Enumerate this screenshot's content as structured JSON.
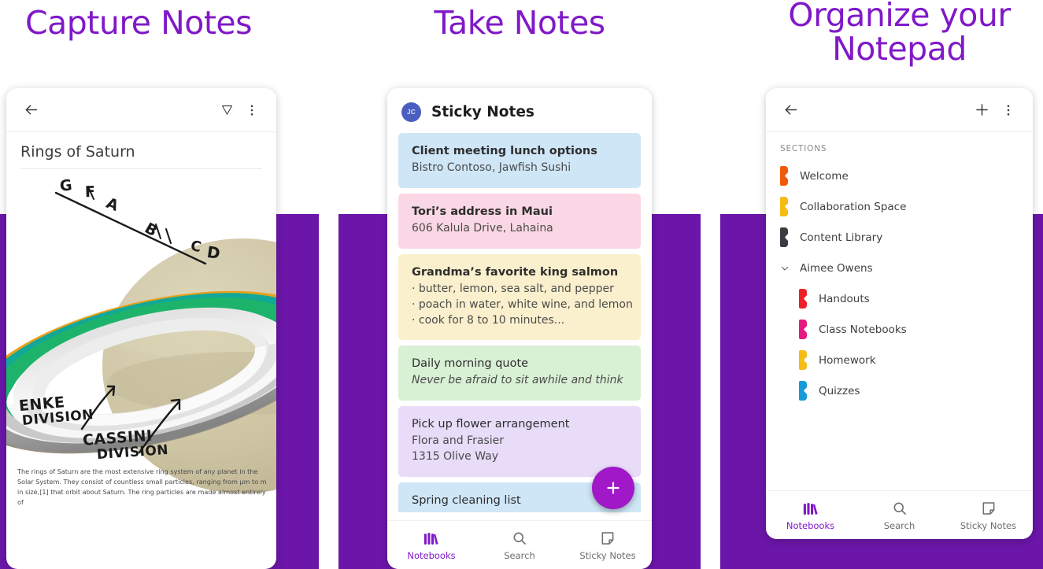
{
  "theme": {
    "purple_backdrop": "#6b16a8",
    "heading_purple": "#8019c8",
    "accent": "#a018c8"
  },
  "panels": [
    {
      "heading": "Capture Notes"
    },
    {
      "heading": "Take Notes"
    },
    {
      "heading": "Organize your\nNotepad"
    }
  ],
  "note_editor": {
    "heading": "Capture Notes",
    "back_icon": "back-arrow-icon",
    "ink_icon": "ink-pen-icon",
    "overflow_icon": "more-vertical-icon",
    "title": "Rings of Saturn",
    "drawing": {
      "ring_labels": [
        "G",
        "F",
        "A",
        "B",
        "C",
        "D"
      ],
      "annotations": [
        "ENKE\nDIVISION",
        "CASSINI\nDIVISION"
      ],
      "annotation_1_line_1": "ENKE",
      "annotation_1_line_2": "DIVISION",
      "annotation_2_line_1": "CASSINI",
      "annotation_2_line_2": "DIVISION",
      "ring_colors": [
        "#e8a11c",
        "#12a898",
        "#1eb36a",
        "#8d8d8d",
        "#cfcfcf",
        "#f2f2f2"
      ],
      "planet_color": "#cdc4a3"
    },
    "body_text": "The rings of Saturn are the most extensive ring system of any planet in the Solar System. They consist of countless small particles, ranging from µm to m in size,[1] that orbit about Saturn. The ring particles are made almost entirely of"
  },
  "sticky_notes": {
    "heading": "Take Notes",
    "avatar_initials": "JC",
    "avatar_color": "#4a5ec0",
    "app_title": "Sticky Notes",
    "fab_icon": "plus-icon",
    "notes": [
      {
        "color": "#cfe6f7",
        "title": "Client meeting lunch options",
        "lines": [
          "Bistro Contoso, Jawfish Sushi"
        ],
        "title_bold": true
      },
      {
        "color": "#fad7e4",
        "title": "Tori’s address in Maui",
        "lines": [
          "606 Kalula Drive, Lahaina"
        ],
        "title_bold": true
      },
      {
        "color": "#fbf0cd",
        "title": "Grandma’s favorite king salmon",
        "lines": [
          "· butter, lemon, sea salt, and pepper",
          "· poach in water, white wine, and lemon",
          "· cook for 8 to 10 minutes..."
        ],
        "title_bold": true
      },
      {
        "color": "#d8f0d4",
        "title": "Daily morning quote",
        "lines": [
          "Never be afraid to sit awhile and think"
        ],
        "title_bold": false,
        "lines_italic": true
      },
      {
        "color": "#e8dcf8",
        "title": "Pick up flower arrangement",
        "lines": [
          "Flora and Frasier",
          "1315 Olive Way"
        ],
        "title_bold": false
      },
      {
        "color": "#cfe6f7",
        "title": "Spring cleaning list",
        "lines": [],
        "title_bold": false
      }
    ],
    "bottom_nav": [
      {
        "label": "Notebooks",
        "icon": "notebooks-icon",
        "active": true
      },
      {
        "label": "Search",
        "icon": "search-icon",
        "active": false
      },
      {
        "label": "Sticky Notes",
        "icon": "sticky-note-icon",
        "active": false
      }
    ]
  },
  "notepad": {
    "heading": "Organize your Notepad",
    "back_icon": "back-arrow-icon",
    "add_icon": "plus-icon",
    "overflow_icon": "more-vertical-icon",
    "sections_label": "SECTIONS",
    "sections": [
      {
        "name": "Welcome",
        "color": "#f05a0f",
        "indent": false
      },
      {
        "name": "Collaboration Space",
        "color": "#f6bb15",
        "indent": false
      },
      {
        "name": "Content Library",
        "color": "#3b3b43",
        "indent": false
      }
    ],
    "group": {
      "name": "Aimee Owens",
      "expanded": true,
      "chevron_icon": "chevron-down-icon",
      "items": [
        {
          "name": "Handouts",
          "color": "#ee2027",
          "indent": true
        },
        {
          "name": "Class Notebooks",
          "color": "#e5197f",
          "indent": true
        },
        {
          "name": "Homework",
          "color": "#f6bb15",
          "indent": true
        },
        {
          "name": "Quizzes",
          "color": "#159bd7",
          "indent": true
        }
      ]
    },
    "bottom_nav": [
      {
        "label": "Notebooks",
        "icon": "notebooks-icon",
        "active": true
      },
      {
        "label": "Search",
        "icon": "search-icon",
        "active": false
      },
      {
        "label": "Sticky Notes",
        "icon": "sticky-note-icon",
        "active": false
      }
    ]
  }
}
